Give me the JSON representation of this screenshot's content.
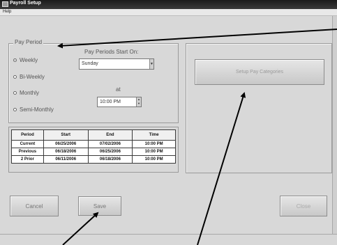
{
  "window": {
    "title": "Payroll Setup"
  },
  "menu": {
    "help": "Help"
  },
  "pay_period": {
    "legend": "Pay Period",
    "options": [
      "Weekly",
      "Bi-Weekly",
      "Monthly",
      "Semi-Monthly"
    ],
    "selected": "Weekly",
    "start_label": "Pay Periods Start On:",
    "start_day": "Sunday",
    "at_label": "at",
    "time": "10:00 PM"
  },
  "periods_table": {
    "headers": [
      "Period",
      "Start",
      "End",
      "Time"
    ],
    "rows": [
      [
        "Current",
        "06/25/2006",
        "07/02/2006",
        "10:00 PM"
      ],
      [
        "Previous",
        "06/18/2006",
        "06/25/2006",
        "10:00 PM"
      ],
      [
        "2 Prior",
        "06/11/2006",
        "06/18/2006",
        "10:00 PM"
      ]
    ]
  },
  "buttons": {
    "setup_categories": "Setup Pay Categories",
    "cancel": "Cancel",
    "save": "Save",
    "close": "Close"
  },
  "colors": {
    "titlebar": "#1b1b1b",
    "window_bg": "#d8d8d8",
    "annotation_arrow": "#000000"
  }
}
